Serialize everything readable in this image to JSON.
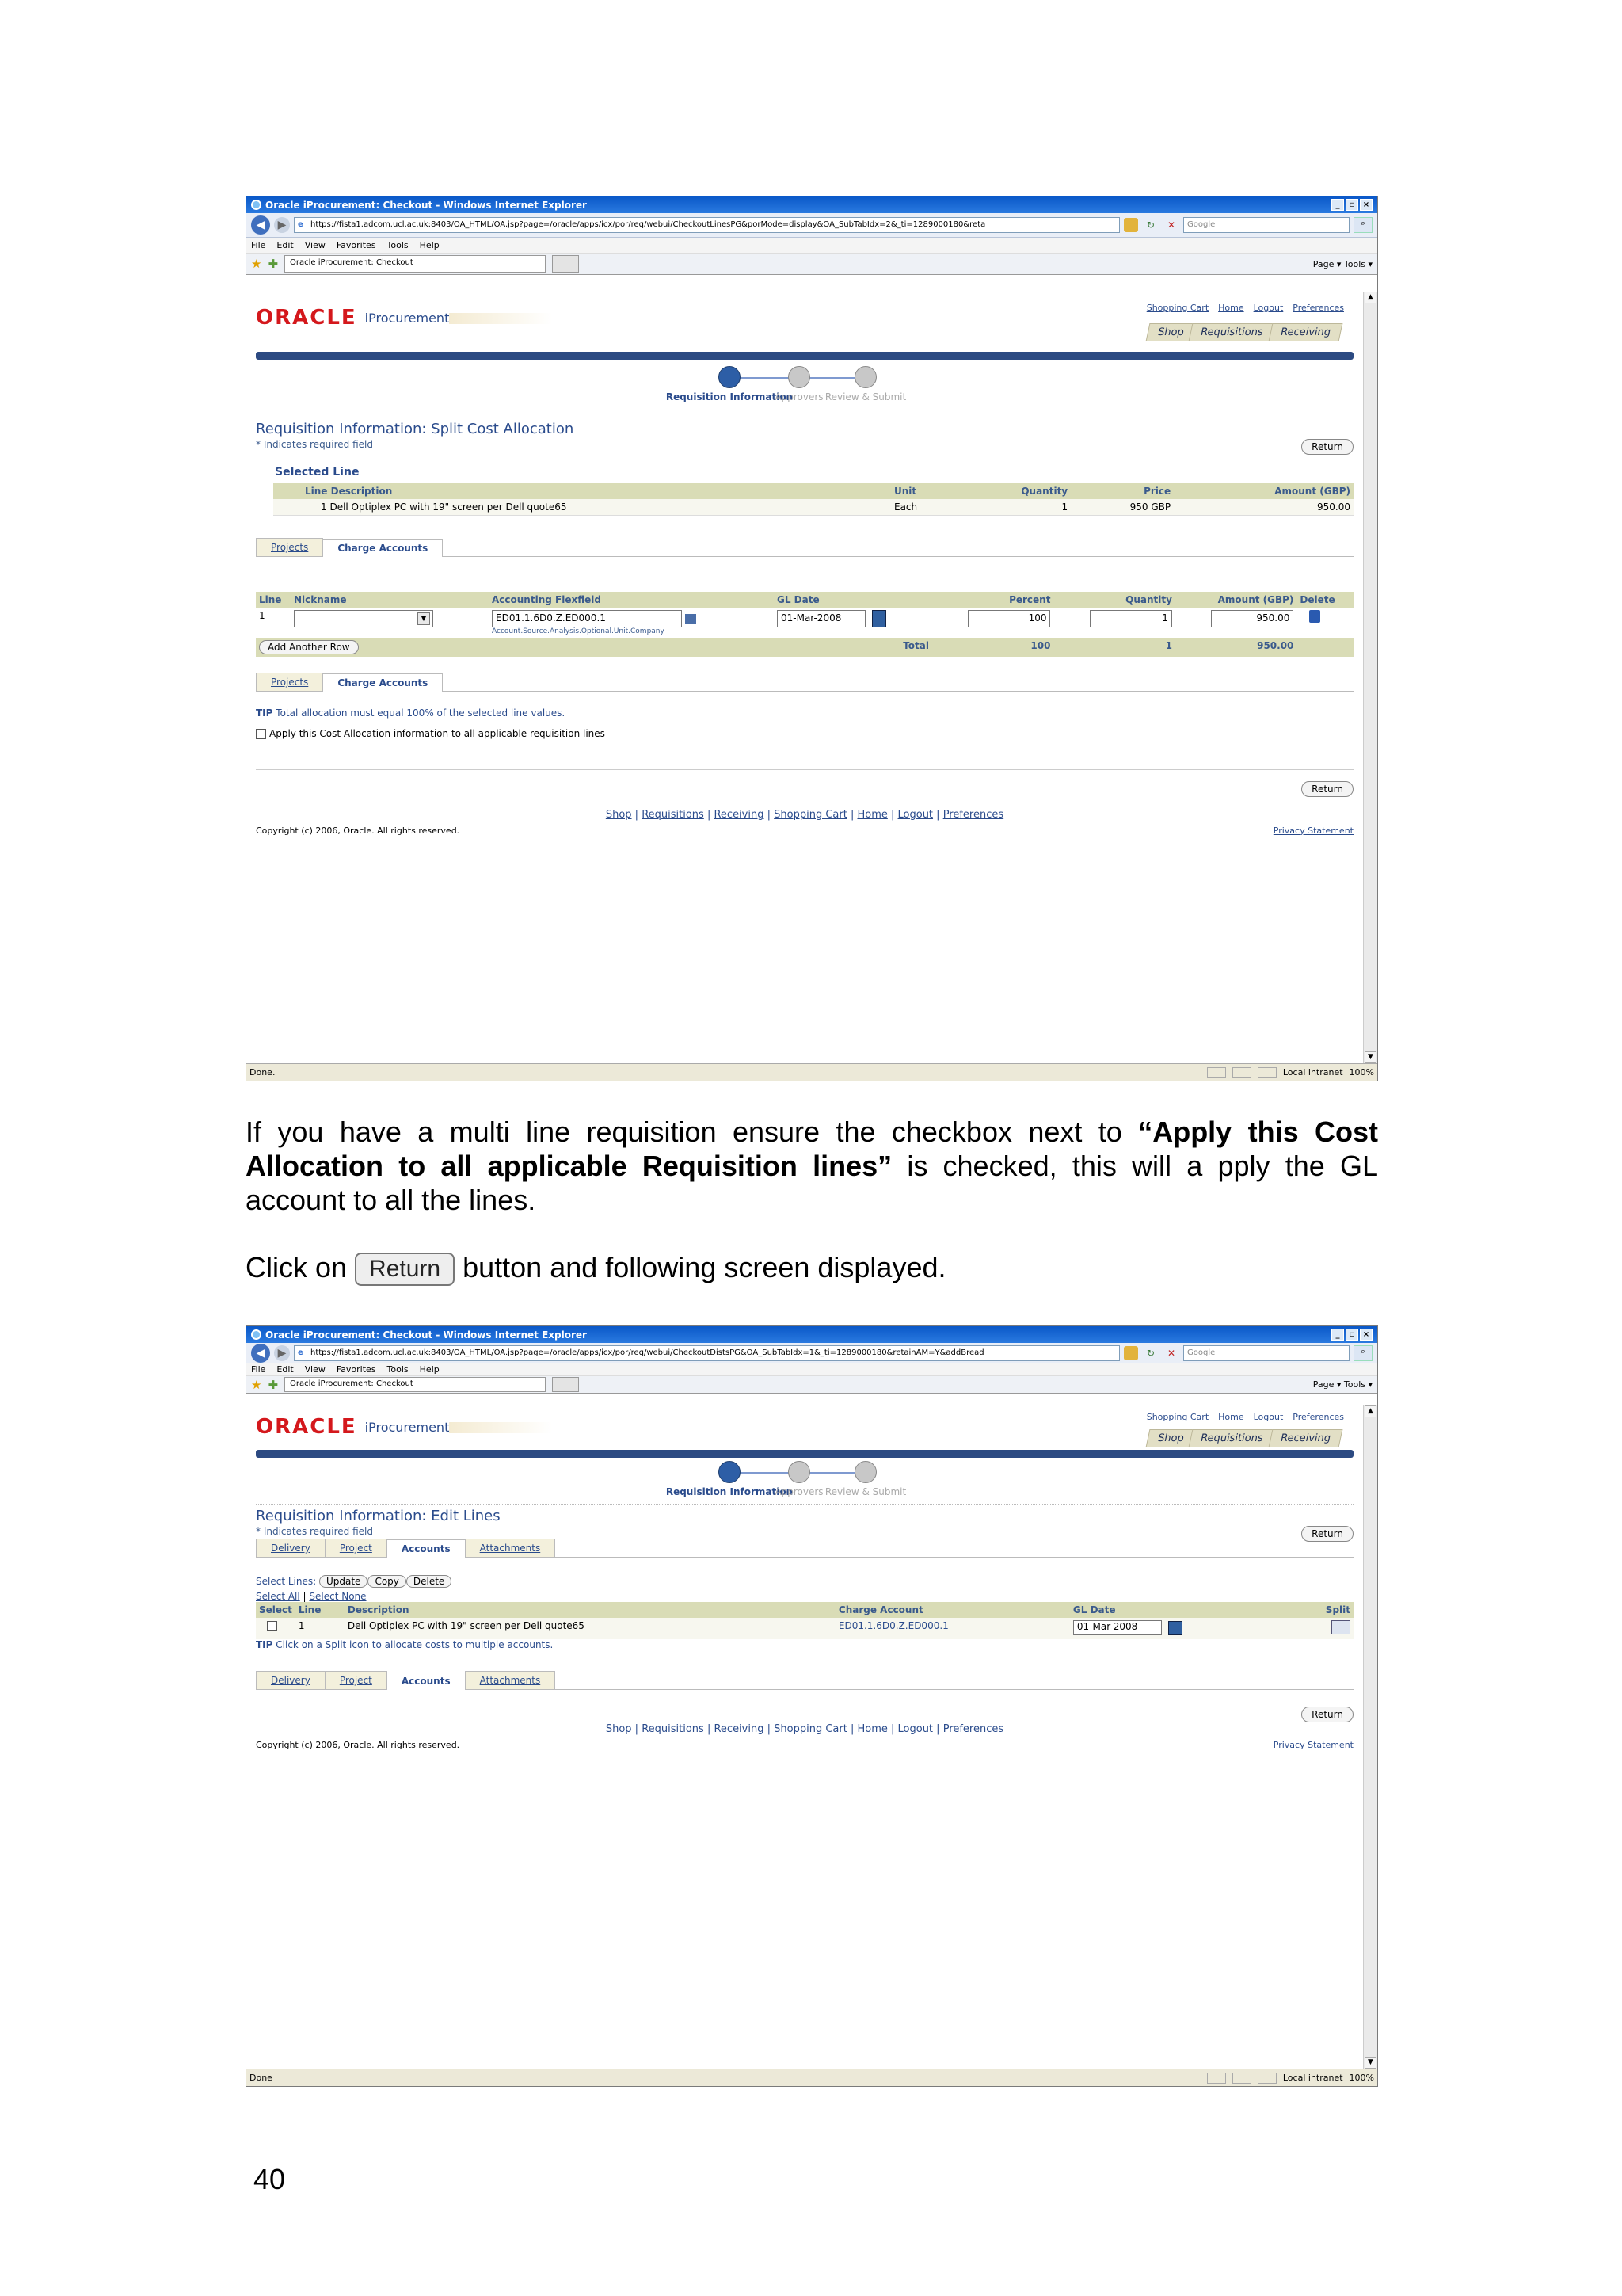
{
  "browser": {
    "title": "Oracle iProcurement: Checkout - Windows Internet Explorer",
    "url1": "https://fista1.adcom.ucl.ac.uk:8403/OA_HTML/OA.jsp?page=/oracle/apps/icx/por/req/webui/CheckoutLinesPG&porMode=display&OA_SubTabIdx=2&_ti=1289000180&reta",
    "url2": "https://fista1.adcom.ucl.ac.uk:8403/OA_HTML/OA.jsp?page=/oracle/apps/icx/por/req/webui/CheckoutDistsPG&OA_SubTabIdx=1&_ti=1289000180&retainAM=Y&addBread",
    "search_placeholder": "Google",
    "menus": [
      "File",
      "Edit",
      "View",
      "Favorites",
      "Tools",
      "Help"
    ],
    "tab": "Oracle iProcurement: Checkout",
    "tools": "Page ▾ Tools ▾",
    "status1": "Done.",
    "status2": "Done",
    "zone": "Local intranet",
    "zoom": "100%"
  },
  "app": {
    "logo": "ORACLE",
    "product": "iProcurement",
    "global_links": [
      "Shopping Cart",
      "Home",
      "Logout",
      "Preferences"
    ],
    "tabs": [
      "Shop",
      "Requisitions",
      "Receiving"
    ],
    "train": [
      "Requisition Information",
      "Approvers",
      "Review & Submit"
    ],
    "required": "* Indicates required field",
    "return": "Return",
    "footer_links": [
      "Shop",
      "Requisitions",
      "Receiving",
      "Shopping Cart",
      "Home",
      "Logout",
      "Preferences"
    ],
    "copyright": "Copyright (c) 2006, Oracle. All rights reserved.",
    "privacy": "Privacy Statement"
  },
  "s1": {
    "heading": "Requisition Information: Split Cost Allocation",
    "selected_line": "Selected Line",
    "line_cols": [
      "Line Description",
      "Unit",
      "Quantity",
      "Price",
      "Amount (GBP)"
    ],
    "line_row": [
      "1 Dell Optiplex PC with 19\" screen per Dell quote65",
      "Each",
      "1",
      "950 GBP",
      "950.00"
    ],
    "subtabs": [
      "Projects",
      "Charge Accounts"
    ],
    "cols": [
      "Line",
      "Nickname",
      "Accounting Flexfield",
      "GL Date",
      "Percent",
      "Quantity",
      "Amount (GBP)",
      "Delete"
    ],
    "row": {
      "line": "1",
      "flex": "ED01.1.6D0.Z.ED000.1",
      "flex_hint": "Account.Source.Analysis.Optional.Unit.Company",
      "gl": "01-Mar-2008",
      "percent": "100",
      "qty": "1",
      "amount": "950.00"
    },
    "add_row": "Add Another Row",
    "total_label": "Total",
    "total": {
      "percent": "100",
      "qty": "1",
      "amount": "950.00"
    },
    "tip": "TIP",
    "tip_text": "Total allocation must equal 100% of the selected line values.",
    "apply": "Apply this Cost Allocation information to all applicable requisition lines"
  },
  "instr": {
    "p1a": "If you have  a multi line requisition   ensure the checkbox next to  ",
    "p1b": "“Apply this Cost Allocation to all applicable Requisition lines”",
    "p1c": " is  checked, this will a pply the GL account to all the lines.",
    "p2a": "Click on ",
    "p2btn": "Return",
    "p2b": " button and following screen displayed."
  },
  "s2": {
    "heading": "Requisition Information: Edit Lines",
    "subtabs": [
      "Delivery",
      "Project",
      "Accounts",
      "Attachments"
    ],
    "select_lines": "Select Lines:",
    "actions": [
      "Update",
      "Copy",
      "Delete"
    ],
    "select_all": "Select All",
    "select_none": "Select None",
    "cols": [
      "Select",
      "Line",
      "Description",
      "Charge Account",
      "GL Date",
      "Split"
    ],
    "row": {
      "line": "1",
      "desc": "Dell Optiplex PC with 19\" screen per Dell quote65",
      "acct": "ED01.1.6D0.Z.ED000.1",
      "gl": "01-Mar-2008"
    },
    "tip": "TIP",
    "tip_text": "Click on a Split icon to allocate costs to multiple accounts."
  },
  "page_number": "40"
}
